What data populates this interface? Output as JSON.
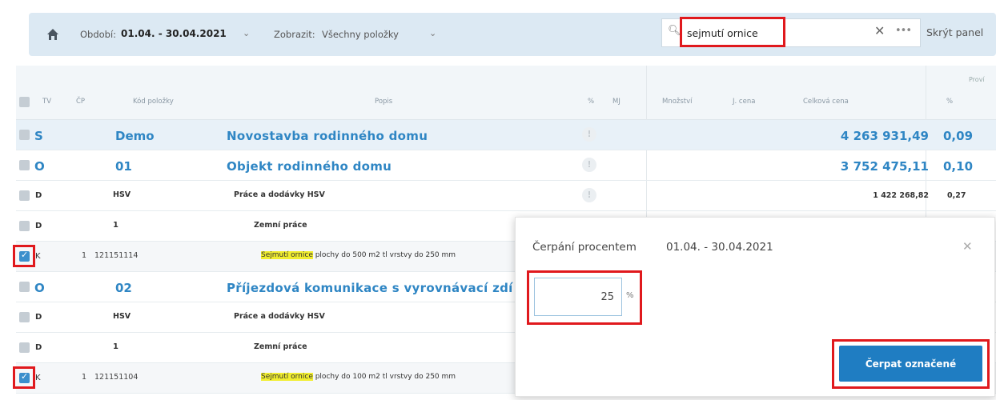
{
  "toolbar": {
    "period_label": "Období:",
    "period_value": "01.04. - 30.04.2021",
    "show_label": "Zobrazit:",
    "show_value": "Všechny položky",
    "search_value": "sejmutí ornice",
    "hide_panel": "Skrýt panel"
  },
  "table": {
    "group_header": "Proví",
    "headers": {
      "tv": "TV",
      "cp": "ČP",
      "code": "Kód položky",
      "name": "Popis",
      "flag": "%",
      "unit": "MJ",
      "qty": "Množství",
      "unit_price": "J. cena",
      "total": "Celková cena",
      "pct": "%"
    },
    "rows": [
      {
        "tv": "S",
        "cp": "",
        "code": "Demo",
        "name": "Novostavba rodinného domu",
        "total": "4 263 931,49",
        "pct": "0,09"
      },
      {
        "tv": "O",
        "cp": "",
        "code": "01",
        "name": "Objekt rodinného domu",
        "total": "3 752 475,11",
        "pct": "0,10"
      },
      {
        "tv": "D",
        "cp": "",
        "code": "HSV",
        "name": "Práce a dodávky HSV",
        "total": "1 422 268,82",
        "pct": "0,27"
      },
      {
        "tv": "D",
        "cp": "",
        "code": "1",
        "name": "Zemní práce",
        "total": "",
        "pct": ""
      },
      {
        "tv": "K",
        "cp": "1",
        "code": "121151114",
        "name_hl": "Sejmutí ornice",
        "name_rest": " plochy do 500 m2 tl vrstvy do 250 mm",
        "checked": true
      },
      {
        "tv": "O",
        "cp": "",
        "code": "02",
        "name": "Příjezdová komunikace s vyrovnávací zdí",
        "total": "",
        "pct": ""
      },
      {
        "tv": "D",
        "cp": "",
        "code": "HSV",
        "name": "Práce a dodávky HSV",
        "total": "",
        "pct": ""
      },
      {
        "tv": "D",
        "cp": "",
        "code": "1",
        "name": "Zemní práce",
        "total": "",
        "pct": ""
      },
      {
        "tv": "K",
        "cp": "1",
        "code": "121151104",
        "name_hl": "Sejmutí ornice",
        "name_rest": " plochy do 100 m2 tl vrstvy do 250 mm",
        "checked": true
      }
    ]
  },
  "modal": {
    "title": "Čerpání procentem",
    "period": "01.04. - 30.04.2021",
    "percent_value": "25",
    "percent_unit": "%",
    "submit_label": "Čerpat označené"
  },
  "colors": {
    "accent": "#2f86c4",
    "highlight_box": "#e0191d",
    "search_match": "#f1ee2f",
    "button": "#1f7dc2"
  },
  "icons": [
    "home-icon",
    "search-icon",
    "clear-icon",
    "more-icon",
    "warning-icon",
    "close-icon",
    "checkbox-icon"
  ]
}
